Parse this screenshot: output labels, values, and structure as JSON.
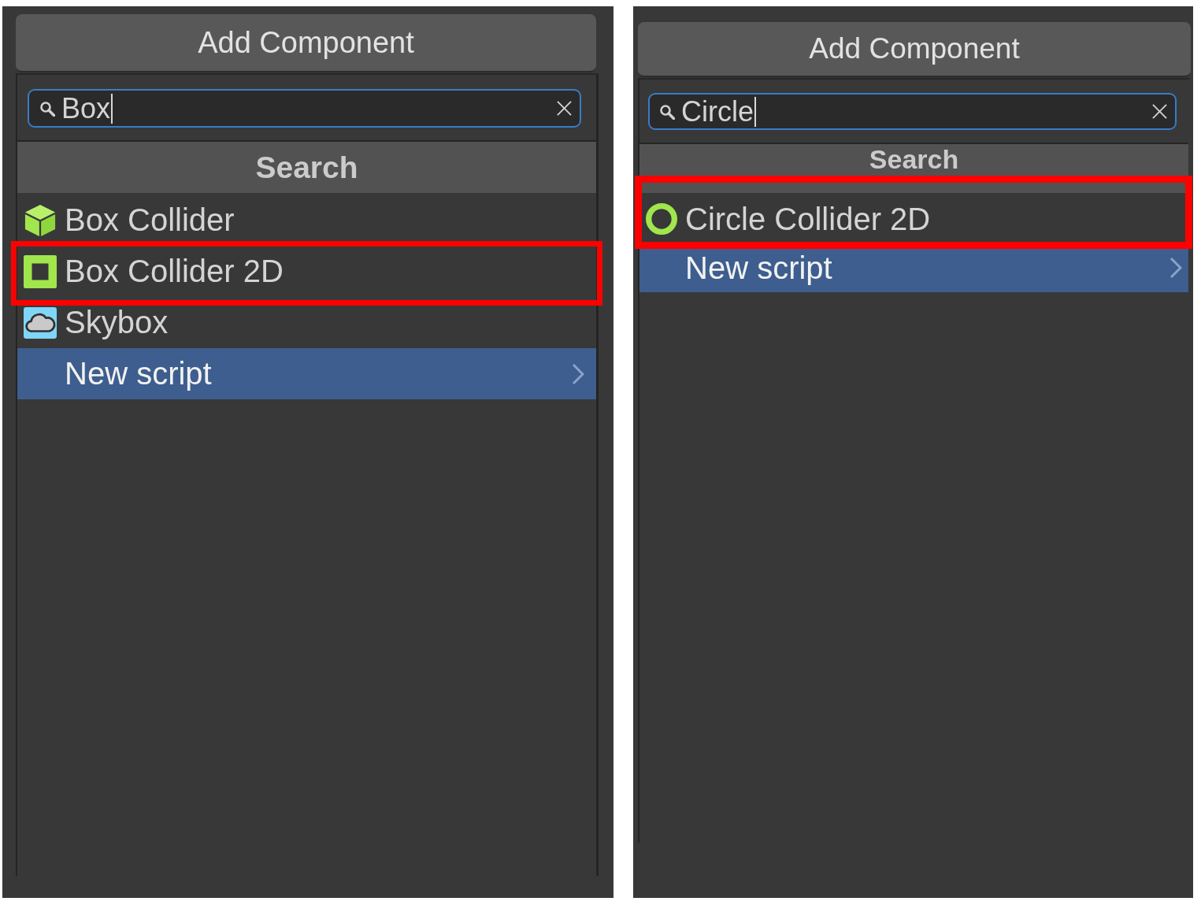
{
  "panels": [
    {
      "button": "Add Component",
      "search": {
        "value": "Box",
        "focused": true
      },
      "section_title": "Search",
      "items": [
        {
          "label": "Box Collider",
          "kind": "cube",
          "selected": false,
          "marked": false,
          "submenu": false
        },
        {
          "label": "Box Collider 2D",
          "kind": "square",
          "selected": false,
          "marked": true,
          "submenu": false
        },
        {
          "label": "Skybox",
          "kind": "cloud",
          "selected": false,
          "marked": false,
          "submenu": false
        },
        {
          "label": "New script",
          "kind": "script",
          "selected": true,
          "marked": false,
          "submenu": true
        }
      ]
    },
    {
      "button": "Add Component",
      "search": {
        "value": "Circle",
        "focused": true
      },
      "section_title": "Search",
      "items": [
        {
          "label": "Circle Collider 2D",
          "kind": "ring",
          "selected": false,
          "marked": true,
          "submenu": false
        },
        {
          "label": "New script",
          "kind": "script",
          "selected": true,
          "marked": false,
          "submenu": true
        }
      ]
    }
  ]
}
